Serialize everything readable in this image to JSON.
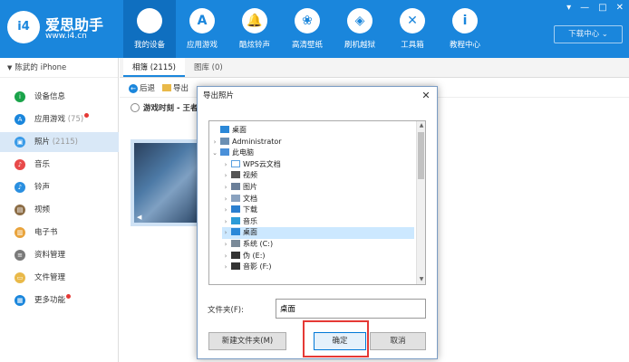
{
  "brand": {
    "logo": "i4",
    "name": "爱思助手",
    "url": "www.i4.cn"
  },
  "nav": [
    {
      "label": "我的设备",
      "icon": "apple-icon",
      "glyph": "",
      "active": true
    },
    {
      "label": "应用游戏",
      "icon": "app-store-icon",
      "glyph": "A"
    },
    {
      "label": "酷炫铃声",
      "icon": "bell-icon",
      "glyph": "🔔"
    },
    {
      "label": "高清壁纸",
      "icon": "flower-icon",
      "glyph": "❀"
    },
    {
      "label": "刷机越狱",
      "icon": "dropbox-icon",
      "glyph": "◈"
    },
    {
      "label": "工具箱",
      "icon": "tools-icon",
      "glyph": "✕"
    },
    {
      "label": "教程中心",
      "icon": "info-icon",
      "glyph": "i"
    }
  ],
  "window_controls": {
    "menu": "▾",
    "minimize": "—",
    "maximize": "□",
    "close": "✕"
  },
  "download_center": "下载中心 ⌄",
  "device": {
    "chevron": "▼",
    "name": "陈武的 iPhone"
  },
  "sidebar": [
    {
      "label": "设备信息",
      "count": "",
      "icon": "device-info-icon",
      "color": "#1aa34a",
      "glyph": "i"
    },
    {
      "label": "应用游戏",
      "count": "(75)",
      "icon": "app-icon",
      "color": "#1a86dc",
      "glyph": "A",
      "dot": true
    },
    {
      "label": "照片",
      "count": "(2115)",
      "icon": "photo-icon",
      "color": "#3a9be8",
      "glyph": "▣",
      "active": true
    },
    {
      "label": "音乐",
      "count": "",
      "icon": "music-icon",
      "color": "#e84a4a",
      "glyph": "♪"
    },
    {
      "label": "铃声",
      "count": "",
      "icon": "bell-icon",
      "color": "#2a8fe0",
      "glyph": "♪"
    },
    {
      "label": "视频",
      "count": "",
      "icon": "video-icon",
      "color": "#8c6d46",
      "glyph": "▤"
    },
    {
      "label": "电子书",
      "count": "",
      "icon": "book-icon",
      "color": "#e9a33b",
      "glyph": "▥"
    },
    {
      "label": "资料管理",
      "count": "",
      "icon": "data-icon",
      "color": "#7a7a7a",
      "glyph": "≡"
    },
    {
      "label": "文件管理",
      "count": "",
      "icon": "file-icon",
      "color": "#e9b949",
      "glyph": "▭"
    },
    {
      "label": "更多功能",
      "count": "",
      "icon": "more-icon",
      "color": "#1a86dc",
      "glyph": "▦",
      "dot": true
    }
  ],
  "tabs": [
    {
      "label": "相簿 (2115)",
      "active": true
    },
    {
      "label": "图库 (0)"
    }
  ],
  "toolbar": {
    "back": "后退",
    "export": "导出"
  },
  "album": "游戏时刻 - 王者荣",
  "dialog": {
    "title": "导出照片",
    "close": "✕",
    "tree": [
      {
        "label": "桌面",
        "level": 0,
        "chev": "",
        "icon": "desktop-icon",
        "color": "#2b88d8"
      },
      {
        "label": "Administrator",
        "level": 0,
        "chev": "›",
        "icon": "user-icon",
        "color": "#6b8fb3"
      },
      {
        "label": "此电脑",
        "level": 0,
        "chev": "⌄",
        "icon": "computer-icon",
        "color": "#4a90d9"
      },
      {
        "label": "WPS云文档",
        "level": 1,
        "chev": "›",
        "icon": "cloud-icon",
        "color": "#ffffff",
        "border": "#5aa0e0"
      },
      {
        "label": "视频",
        "level": 1,
        "chev": "›",
        "icon": "video-folder-icon",
        "color": "#555555"
      },
      {
        "label": "图片",
        "level": 1,
        "chev": "›",
        "icon": "picture-folder-icon",
        "color": "#6b7f99"
      },
      {
        "label": "文档",
        "level": 1,
        "chev": "›",
        "icon": "documents-folder-icon",
        "color": "#8aa2bf"
      },
      {
        "label": "下载",
        "level": 1,
        "chev": "›",
        "icon": "download-folder-icon",
        "color": "#2b7fd0"
      },
      {
        "label": "音乐",
        "level": 1,
        "chev": "›",
        "icon": "music-folder-icon",
        "color": "#2b9bd8"
      },
      {
        "label": "桌面",
        "level": 1,
        "chev": "›",
        "icon": "desktop-folder-icon",
        "color": "#2b88d8",
        "selected": true
      },
      {
        "label": "系统 (C:)",
        "level": 1,
        "chev": "›",
        "icon": "drive-c-icon",
        "color": "#7a8a99"
      },
      {
        "label": "伪 (E:)",
        "level": 1,
        "chev": "›",
        "icon": "drive-e-icon",
        "color": "#333333"
      },
      {
        "label": "音影 (F:)",
        "level": 1,
        "chev": "›",
        "icon": "drive-f-icon",
        "color": "#333333"
      }
    ],
    "folder_label": "文件夹(F):",
    "folder_value": "桌面",
    "new_folder": "新建文件夹(M)",
    "ok": "确定",
    "cancel": "取消"
  },
  "colors": {
    "brand": "#1a86dc",
    "highlight": "#e53935"
  }
}
